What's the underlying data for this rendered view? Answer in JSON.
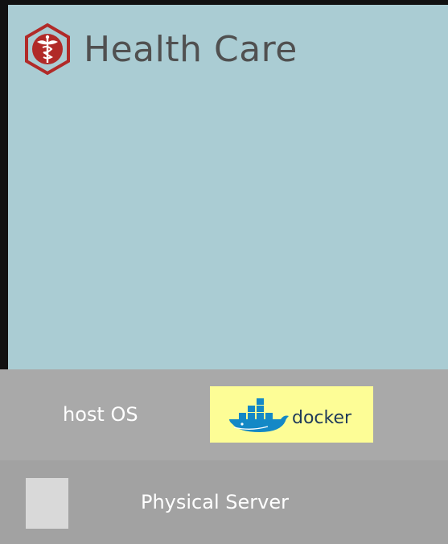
{
  "app": {
    "title": "Health Care",
    "icon": "caduceus-icon",
    "color": "#b12a28"
  },
  "host_os": {
    "label": "host OS",
    "runtime_logo": "docker-logo",
    "runtime_logo_text": "docker"
  },
  "physical_server": {
    "label": "Physical Server"
  },
  "colors": {
    "app_background": "#aaccd3",
    "host_os_background": "#a9a9a9",
    "server_background": "#a2a2a2",
    "docker_highlight": "#fdfd96",
    "docker_blue": "#1488c6"
  }
}
